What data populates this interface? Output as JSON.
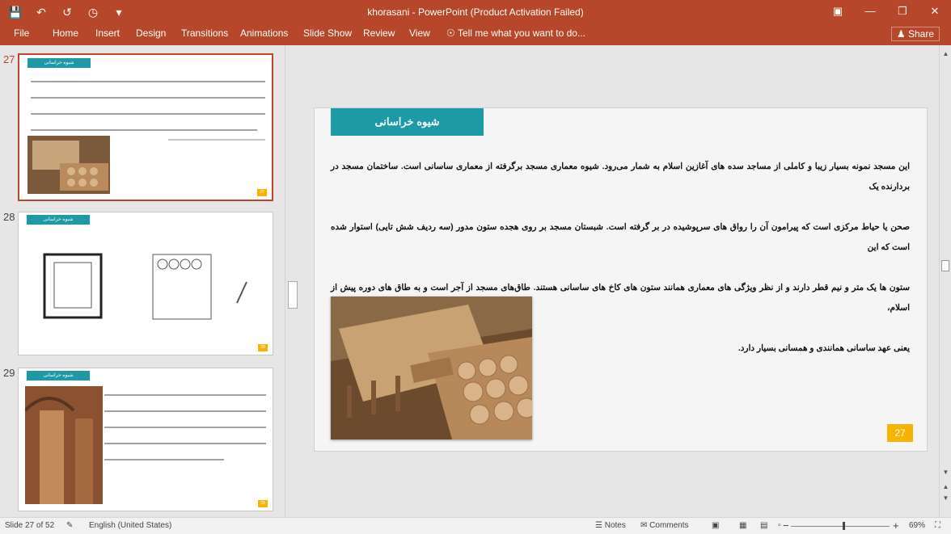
{
  "window": {
    "title": "khorasani  -  PowerPoint (Product Activation Failed)",
    "qat_icons": [
      "save-icon",
      "undo-icon",
      "redo-icon",
      "start-from-beginning-icon",
      "customize-qat-icon"
    ],
    "controls": [
      "ribbon-display-options-icon",
      "minimize-icon",
      "restore-icon",
      "close-icon"
    ]
  },
  "ribbon": {
    "tabs": [
      "File",
      "Home",
      "Insert",
      "Design",
      "Transitions",
      "Animations",
      "Slide Show",
      "Review",
      "View"
    ],
    "tell_me": "Tell me what you want to do...",
    "share": "Share"
  },
  "thumbnails": [
    {
      "number": "27",
      "active": true,
      "badge": "شیوه خراسانی",
      "slide_number": "27"
    },
    {
      "number": "28",
      "active": false,
      "badge": "شیوه خراسانی",
      "slide_number": "28"
    },
    {
      "number": "29",
      "active": false,
      "badge": "شیوه خراسانی",
      "slide_number": "29"
    }
  ],
  "slide": {
    "title": "شیوه خراسانی",
    "paragraphs": [
      "این مسجد نمونه بسیار زیبا و کاملی از مساجد سده های آغازین اسلام به شمار می‌رود. شیوه معماری مسجد برگرفته از معماری ساسانی است. ساختمان مسجد در بردارنده یک",
      "صحن یا حیاط مرکزی است که پیرامون آن را رواق های سرپوشیده در بر گرفته است. شبستان مسجد بر روی هجده ستون مدور (سه ردیف شش تایی) استوار شده است که این",
      "ستون ها یک متر و نیم قطر دارند و از نظر ویژگی های معماری همانند ستون های کاخ های ساسانی هستند. طاق‌های مسجد از آجر است و به طاق های دوره پیش از اسلام،",
      "یعنی عهد ساسانی همانندی و همسانی بسیار دارد."
    ],
    "slide_number": "27"
  },
  "status": {
    "slide_info": "Slide 27 of 52",
    "language": "English (United States)",
    "notes": "Notes",
    "comments": "Comments",
    "zoom": "69%",
    "zoom_percent": 69
  },
  "colors": {
    "accent": "#b7472a",
    "teal": "#1e9aa6",
    "gold": "#f5b400"
  }
}
